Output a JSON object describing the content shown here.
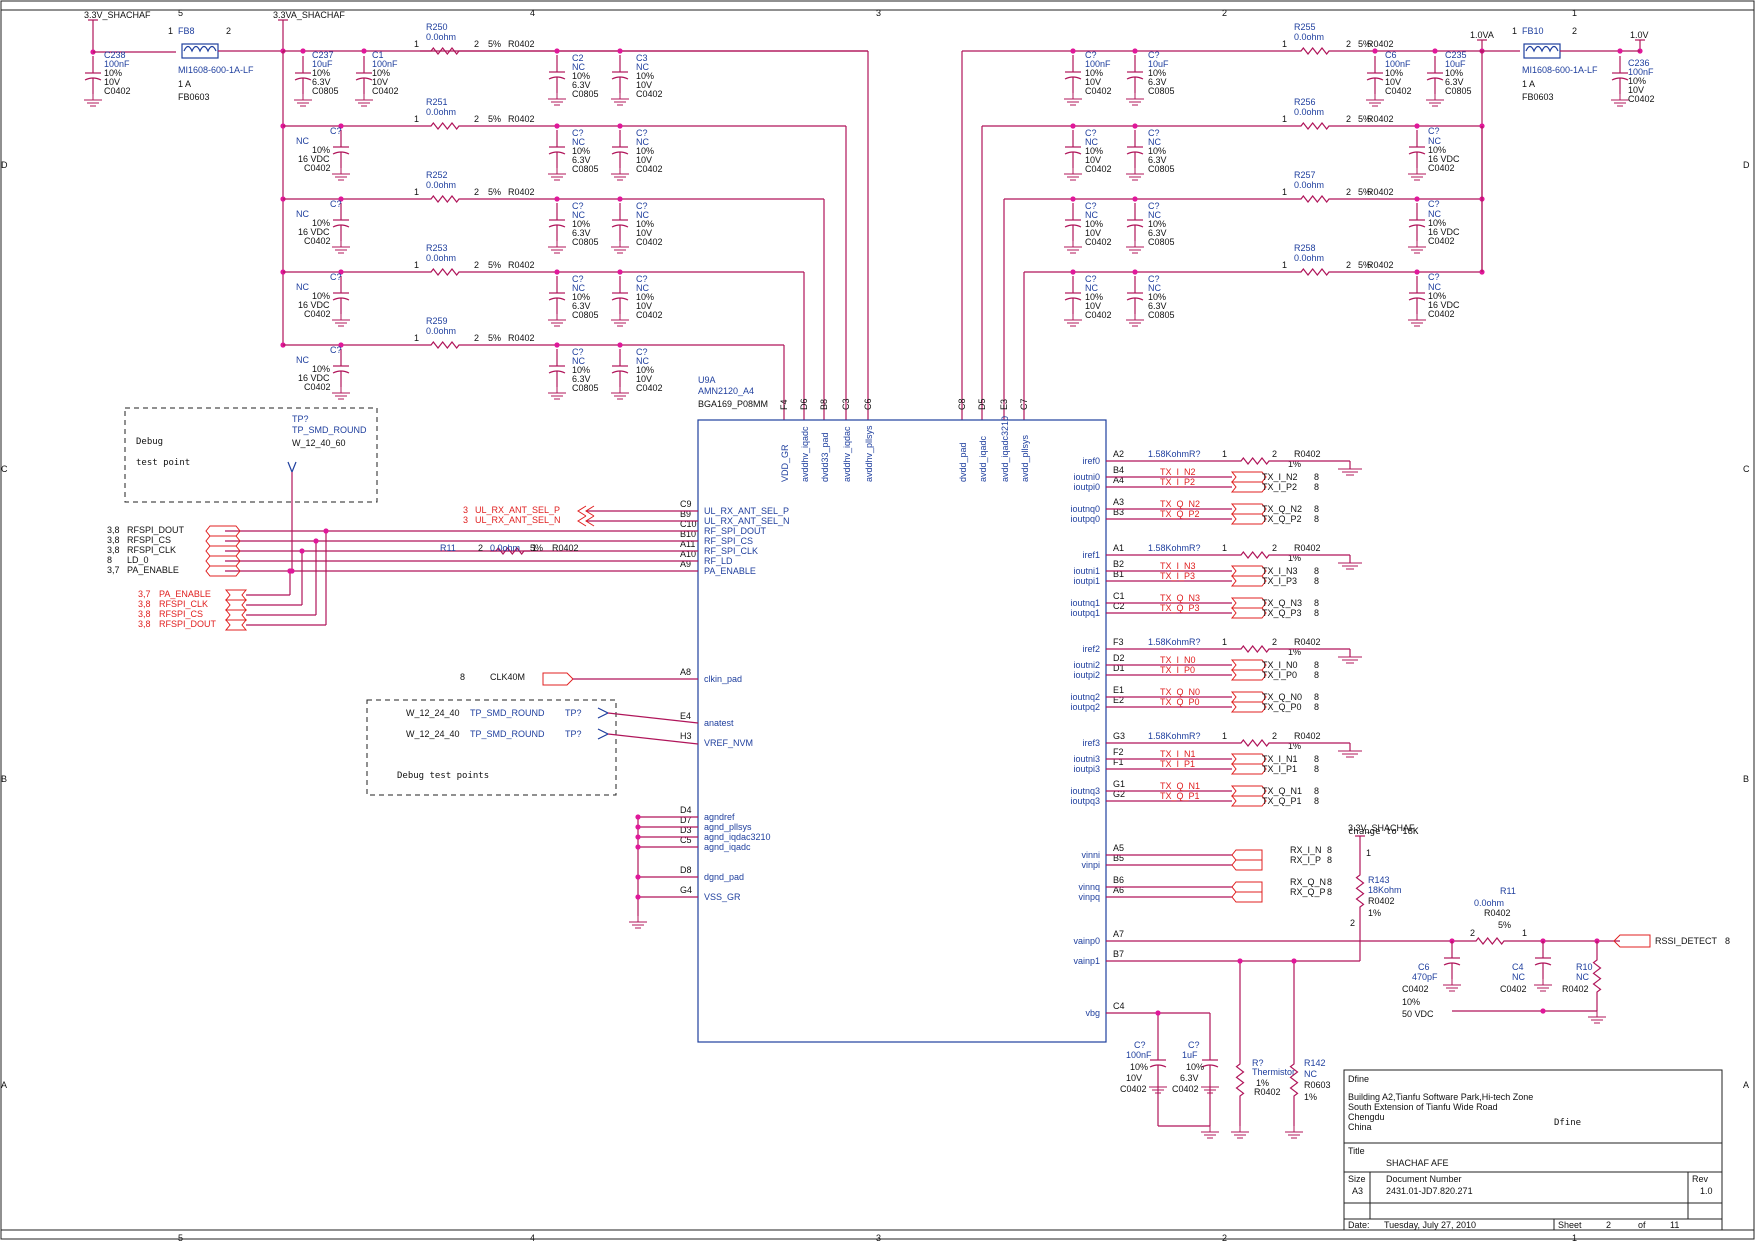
{
  "title_block": {
    "company": "Dfine",
    "logo_text": "Dfine",
    "address": [
      "Building A2,Tianfu Software Park,Hi-tech Zone",
      "South Extension of Tianfu Wide Road",
      "Chengdu",
      "China"
    ],
    "title_label": "Title",
    "title": "SHACHAF AFE",
    "size_label": "Size",
    "size": "A3",
    "docnum_label": "Document Number",
    "docnum": "2431.01-JD7.820.271",
    "rev_label": "Rev",
    "rev": "1.0",
    "date_label": "Date:",
    "date": "Tuesday, July 27, 2010",
    "sheet_label": "Sheet",
    "sheet": "2",
    "of_label": "of",
    "of": "11"
  },
  "zones": {
    "cols": [
      "5",
      "4",
      "3",
      "2",
      "1"
    ],
    "rows": [
      "D",
      "C",
      "B",
      "A"
    ]
  },
  "power_nets": {
    "left_supply": "3.3V_SHACHAF",
    "analog_supply": "3.3VA_SHACHAF",
    "core_1v0a": "1.0VA",
    "core_1v0": "1.0V",
    "rssi_supply": "3.3V_SHACHAF"
  },
  "ferrites": [
    {
      "ref": "FB8",
      "part": "MI1608-600-1A-LF",
      "rating": "1 A",
      "pkg": "FB0603"
    },
    {
      "ref": "FB10",
      "part": "MI1608-600-1A-LF",
      "rating": "1 A",
      "pkg": "FB0603"
    }
  ],
  "left_caps": [
    {
      "ref": "C238",
      "value": "100nF",
      "tol": "10%",
      "volt": "10V",
      "pkg": "C0402"
    },
    {
      "ref": "C237",
      "value": "10uF",
      "tol": "10%",
      "volt": "6.3V",
      "pkg": "C0805"
    },
    {
      "ref": "C1",
      "value": "100nF",
      "tol": "10%",
      "volt": "10V",
      "pkg": "C0402"
    }
  ],
  "right_top_caps": [
    {
      "ref": "C?",
      "value": "100nF",
      "tol": "10%",
      "volt": "10V",
      "pkg": "C0402"
    },
    {
      "ref": "C?",
      "value": "10uF",
      "tol": "10%",
      "volt": "6.3V",
      "pkg": "C0805"
    },
    {
      "ref": "C6",
      "value": "100nF",
      "tol": "10%",
      "volt": "10V",
      "pkg": "C0402"
    },
    {
      "ref": "C235",
      "value": "10uF",
      "tol": "10%",
      "volt": "6.3V",
      "pkg": "C0805"
    },
    {
      "ref": "C236",
      "value": "100nF",
      "tol": "10%",
      "volt": "10V",
      "pkg": "C0402"
    }
  ],
  "left_rails": [
    {
      "res": "R250",
      "rv": "0.0ohm",
      "tol": "5%",
      "pkg": "R0402",
      "capA": {
        "ref": "C2",
        "value": "NC",
        "tol": "10%",
        "volt": "6.3V",
        "pkg": "C0805"
      },
      "capB": {
        "ref": "C3",
        "value": "NC",
        "tol": "10%",
        "volt": "10V",
        "pkg": "C0402"
      }
    },
    {
      "res": "R251",
      "rv": "0.0ohm",
      "tol": "5%",
      "pkg": "R0402",
      "capA": {
        "ref": "C?",
        "value": "NC",
        "tol": "10%",
        "volt": "6.3V",
        "pkg": "C0805"
      },
      "capB": {
        "ref": "C?",
        "value": "NC",
        "tol": "10%",
        "volt": "10V",
        "pkg": "C0402"
      }
    },
    {
      "res": "R252",
      "rv": "0.0ohm",
      "tol": "5%",
      "pkg": "R0402",
      "capA": {
        "ref": "C?",
        "value": "NC",
        "tol": "10%",
        "volt": "6.3V",
        "pkg": "C0805"
      },
      "capB": {
        "ref": "C?",
        "value": "NC",
        "tol": "10%",
        "volt": "10V",
        "pkg": "C0402"
      }
    },
    {
      "res": "R253",
      "rv": "0.0ohm",
      "tol": "5%",
      "pkg": "R0402",
      "capA": {
        "ref": "C?",
        "value": "NC",
        "tol": "10%",
        "volt": "6.3V",
        "pkg": "C0805"
      },
      "capB": {
        "ref": "C?",
        "value": "NC",
        "tol": "10%",
        "volt": "10V",
        "pkg": "C0402"
      }
    },
    {
      "res": "R259",
      "rv": "0.0ohm",
      "tol": "5%",
      "pkg": "R0402",
      "capA": {
        "ref": "C?",
        "value": "NC",
        "tol": "10%",
        "volt": "6.3V",
        "pkg": "C0805"
      },
      "capB": {
        "ref": "C?",
        "value": "NC",
        "tol": "10%",
        "volt": "10V",
        "pkg": "C0402"
      }
    }
  ],
  "bulk_caps_left": {
    "ref": "C?",
    "value": "NC",
    "tol": "10%",
    "volt": "16 VDC",
    "pkg": "C0402"
  },
  "right_rails": [
    {
      "res": "R255",
      "rv": "0.0ohm",
      "tol": "5%",
      "pkg": "R0402"
    },
    {
      "res": "R256",
      "rv": "0.0ohm",
      "tol": "5%",
      "pkg": "R0402",
      "capA": {
        "ref": "C?",
        "value": "NC",
        "tol": "10%",
        "volt": "10V",
        "pkg": "C0402"
      },
      "capB": {
        "ref": "C?",
        "value": "NC",
        "tol": "10%",
        "volt": "6.3V",
        "pkg": "C0805"
      }
    },
    {
      "res": "R257",
      "rv": "0.0ohm",
      "tol": "5%",
      "pkg": "R0402",
      "capA": {
        "ref": "C?",
        "value": "NC",
        "tol": "10%",
        "volt": "10V",
        "pkg": "C0402"
      },
      "capB": {
        "ref": "C?",
        "value": "NC",
        "tol": "10%",
        "volt": "6.3V",
        "pkg": "C0805"
      }
    },
    {
      "res": "R258",
      "rv": "0.0ohm",
      "tol": "5%",
      "pkg": "R0402",
      "capA": {
        "ref": "C?",
        "value": "NC",
        "tol": "10%",
        "volt": "10V",
        "pkg": "C0402"
      },
      "capB": {
        "ref": "C?",
        "value": "NC",
        "tol": "10%",
        "volt": "6.3V",
        "pkg": "C0805"
      }
    }
  ],
  "bulk_caps_right": {
    "ref": "C?",
    "value": "NC",
    "tol": "10%",
    "volt": "16 VDC",
    "pkg": "C0402"
  },
  "ic": {
    "ref": "U9A",
    "part": "AMN2120_A4",
    "pkg": "BGA169_P08MM",
    "top_pins": [
      {
        "ball": "F4",
        "name": "VDD_GR"
      },
      {
        "ball": "D6",
        "name": "avddhv_iqadc"
      },
      {
        "ball": "B8",
        "name": "dvdd33_pad"
      },
      {
        "ball": "C3",
        "name": "avddhv_iqdac"
      },
      {
        "ball": "C6",
        "name": "avddhv_pllsys"
      },
      {
        "ball": "C8",
        "name": "dvdd_pad"
      },
      {
        "ball": "D5",
        "name": "avdd_iqadc"
      },
      {
        "ball": "E3",
        "name": "avdd_iqadc3210"
      },
      {
        "ball": "C7",
        "name": "avdd_pllsys"
      }
    ],
    "left_pins": [
      {
        "ball": "C9",
        "name": "UL_RX_ANT_SEL_P"
      },
      {
        "ball": "B9",
        "name": "UL_RX_ANT_SEL_N"
      },
      {
        "ball": "C10",
        "name": "RF_SPI_DOUT"
      },
      {
        "ball": "B10",
        "name": "RF_SPI_CS"
      },
      {
        "ball": "A11",
        "name": "RF_SPI_CLK"
      },
      {
        "ball": "A10",
        "name": "RF_LD"
      },
      {
        "ball": "A9",
        "name": "PA_ENABLE"
      },
      {
        "ball": "A8",
        "name": "clkin_pad"
      },
      {
        "ball": "E4",
        "name": "anatest"
      },
      {
        "ball": "H3",
        "name": "VREF_NVM"
      },
      {
        "ball": "D4",
        "name": "agndref"
      },
      {
        "ball": "D7",
        "name": "agnd_pllsys"
      },
      {
        "ball": "D3",
        "name": "agnd_iqdac3210"
      },
      {
        "ball": "C5",
        "name": "agnd_iqadc"
      },
      {
        "ball": "D8",
        "name": "dgnd_pad"
      },
      {
        "ball": "G4",
        "name": "VSS_GR"
      }
    ],
    "right_pins": [
      {
        "ball": "A2",
        "name": "iref0"
      },
      {
        "ball": "B4",
        "name": "ioutni0"
      },
      {
        "ball": "A4",
        "name": "ioutpi0"
      },
      {
        "ball": "A3",
        "name": "ioutnq0"
      },
      {
        "ball": "B3",
        "name": "ioutpq0"
      },
      {
        "ball": "A1",
        "name": "iref1"
      },
      {
        "ball": "B2",
        "name": "ioutni1"
      },
      {
        "ball": "B1",
        "name": "ioutpi1"
      },
      {
        "ball": "C1",
        "name": "ioutnq1"
      },
      {
        "ball": "C2",
        "name": "ioutpq1"
      },
      {
        "ball": "F3",
        "name": "iref2"
      },
      {
        "ball": "D2",
        "name": "ioutni2"
      },
      {
        "ball": "D1",
        "name": "ioutpi2"
      },
      {
        "ball": "E1",
        "name": "ioutnq2"
      },
      {
        "ball": "E2",
        "name": "ioutpq2"
      },
      {
        "ball": "G3",
        "name": "iref3"
      },
      {
        "ball": "F2",
        "name": "ioutni3"
      },
      {
        "ball": "F1",
        "name": "ioutpi3"
      },
      {
        "ball": "G1",
        "name": "ioutnq3"
      },
      {
        "ball": "G2",
        "name": "ioutpq3"
      },
      {
        "ball": "A5",
        "name": "vinni"
      },
      {
        "ball": "B5",
        "name": "vinpi"
      },
      {
        "ball": "B6",
        "name": "vinnq"
      },
      {
        "ball": "A6",
        "name": "vinpq"
      },
      {
        "ball": "A7",
        "name": "vainp0"
      },
      {
        "ball": "B7",
        "name": "vainp1"
      },
      {
        "ball": "C4",
        "name": "vbg"
      }
    ]
  },
  "iref_resistors": [
    {
      "ref": "R?",
      "value": "1.58Kohm",
      "tol": "1%",
      "pkg": "R0402"
    },
    {
      "ref": "R?",
      "value": "1.58Kohm",
      "tol": "1%",
      "pkg": "R0402"
    },
    {
      "ref": "R?",
      "value": "1.58Kohm",
      "tol": "1%",
      "pkg": "R0402"
    },
    {
      "ref": "R?",
      "value": "1.58Kohm",
      "tol": "1%",
      "pkg": "R0402"
    }
  ],
  "tx_nets": [
    {
      "local": "TX_I_N2",
      "port": "TX_I_N2",
      "sheet": "8"
    },
    {
      "local": "TX_I_P2",
      "port": "TX_I_P2",
      "sheet": "8"
    },
    {
      "local": "TX_Q_N2",
      "port": "TX_Q_N2",
      "sheet": "8"
    },
    {
      "local": "TX_Q_P2",
      "port": "TX_Q_P2",
      "sheet": "8"
    },
    {
      "local": "TX_I_N3",
      "port": "TX_I_N3",
      "sheet": "8"
    },
    {
      "local": "TX_I_P3",
      "port": "TX_I_P3",
      "sheet": "8"
    },
    {
      "local": "TX_Q_N3",
      "port": "TX_Q_N3",
      "sheet": "8"
    },
    {
      "local": "TX_Q_P3",
      "port": "TX_Q_P3",
      "sheet": "8"
    },
    {
      "local": "TX_I_N0",
      "port": "TX_I_N0",
      "sheet": "8"
    },
    {
      "local": "TX_I_P0",
      "port": "TX_I_P0",
      "sheet": "8"
    },
    {
      "local": "TX_Q_N0",
      "port": "TX_Q_N0",
      "sheet": "8"
    },
    {
      "local": "TX_Q_P0",
      "port": "TX_Q_P0",
      "sheet": "8"
    },
    {
      "local": "TX_I_N1",
      "port": "TX_I_N1",
      "sheet": "8"
    },
    {
      "local": "TX_I_P1",
      "port": "TX_I_P1",
      "sheet": "8"
    },
    {
      "local": "TX_Q_N1",
      "port": "TX_Q_N1",
      "sheet": "8"
    },
    {
      "local": "TX_Q_P1",
      "port": "TX_Q_P1",
      "sheet": "8"
    }
  ],
  "rx_nets": [
    {
      "port": "RX_I_N",
      "sheet": "8"
    },
    {
      "port": "RX_I_P",
      "sheet": "8"
    },
    {
      "port": "RX_Q_N",
      "sheet": "8"
    },
    {
      "port": "RX_Q_P",
      "sheet": "8"
    }
  ],
  "left_ports": [
    {
      "sheet": "3,8",
      "name": "RFSPI_DOUT"
    },
    {
      "sheet": "3,8",
      "name": "RFSPI_CS"
    },
    {
      "sheet": "3,8",
      "name": "RFSPI_CLK"
    },
    {
      "sheet": "8",
      "name": "LD_0"
    },
    {
      "sheet": "3,7",
      "name": "PA_ENABLE"
    }
  ],
  "red_ports": [
    {
      "sheet": "3,7",
      "name": "PA_ENABLE"
    },
    {
      "sheet": "3,8",
      "name": "RFSPI_CLK"
    },
    {
      "sheet": "3,8",
      "name": "RFSPI_CS"
    },
    {
      "sheet": "3,8",
      "name": "RFSPI_DOUT"
    }
  ],
  "ant_sel": [
    {
      "sheet": "3",
      "name": "UL_RX_ANT_SEL_P"
    },
    {
      "sheet": "3",
      "name": "UL_RX_ANT_SEL_N"
    }
  ],
  "r11_spi": {
    "ref": "R11",
    "value": "0.0ohm",
    "tol": "5%",
    "pkg": "R0402"
  },
  "clk": {
    "sheet": "8",
    "name": "CLK40M"
  },
  "debug_tp": {
    "label": "Debug test point",
    "line1": "Debug",
    "line2": "test point",
    "ref": "TP?",
    "part": "TP_SMD_ROUND",
    "pkg": "W_12_40_60"
  },
  "debug_tps": {
    "label": "Debug test points",
    "points": [
      {
        "pkg": "W_12_24_40",
        "part": "TP_SMD_ROUND",
        "ref": "TP?"
      },
      {
        "pkg": "W_12_24_40",
        "part": "TP_SMD_ROUND",
        "ref": "TP?"
      }
    ]
  },
  "rssi": {
    "note": "change to 18K",
    "r143": {
      "ref": "R143",
      "value": "18Kohm",
      "pkg": "R0402",
      "tol": "1%"
    },
    "r11": {
      "ref": "R11",
      "value": "0.0ohm",
      "pkg": "R0402",
      "tol": "5%"
    },
    "c6": {
      "ref": "C6",
      "value": "470pF",
      "pkg": "C0402",
      "tol": "10%",
      "volt": "50 VDC"
    },
    "c4": {
      "ref": "C4",
      "value": "NC",
      "pkg": "C0402"
    },
    "r10": {
      "ref": "R10",
      "value": "NC",
      "pkg": "R0402"
    },
    "port": "RSSI_DETECT",
    "port_sheet": "8"
  },
  "vbg": {
    "c1": {
      "ref": "C?",
      "value": "100nF",
      "tol": "10%",
      "volt": "10V",
      "pkg": "C0402"
    },
    "c2": {
      "ref": "C?",
      "value": "1uF",
      "tol": "10%",
      "volt": "6.3V",
      "pkg": "C0402"
    },
    "therm": {
      "ref": "R?",
      "value": "Thermistor",
      "tol": "1%",
      "pkg": "R0402"
    },
    "r142": {
      "ref": "R142",
      "value": "NC",
      "pkg": "R0603",
      "tol": "1%"
    }
  },
  "colors": {
    "wire": "#b0155a",
    "ref": "#1f3f9e",
    "port_red": "#e02020",
    "junction": "#e0189a"
  }
}
